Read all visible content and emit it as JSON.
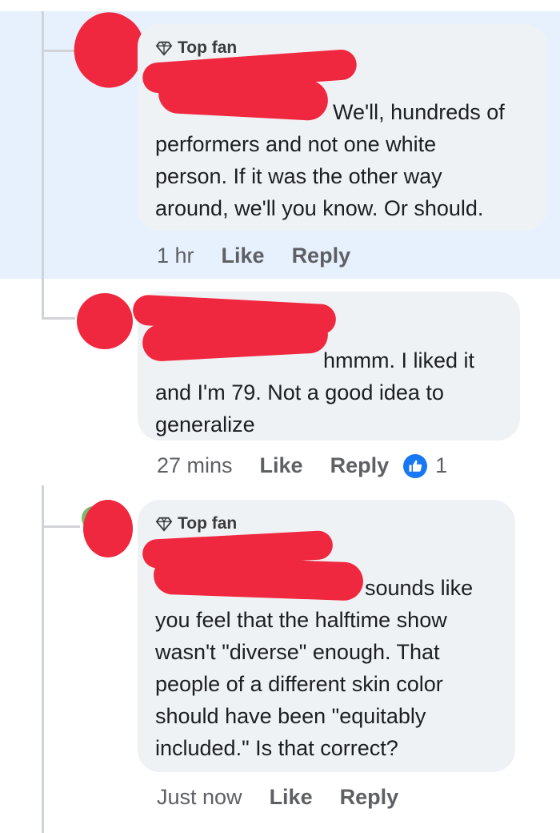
{
  "colors": {
    "highlight": "#e7f1fe",
    "bubble": "#eff2f5",
    "redaction": "#f0283f",
    "like_blue": "#1877f2"
  },
  "comments": [
    {
      "badge": "Top fan",
      "text_lines": [
        "We'll, hundreds of",
        "performers and not one white",
        "person. If it was the other way",
        "around, we'll you know. Or should."
      ],
      "time": "1 hr",
      "like": "Like",
      "reply": "Reply"
    },
    {
      "text_lines": [
        "hmmm. I liked it",
        "and I'm 79. Not a good idea to",
        "generalize"
      ],
      "time": "27 mins",
      "like": "Like",
      "reply": "Reply",
      "reaction_count": "1",
      "reaction_icon": "thumbs-up-icon"
    },
    {
      "badge": "Top fan",
      "text_lines": [
        "sounds like",
        "you feel that the halftime show",
        "wasn't \"diverse\" enough. That",
        "people of a different skin color",
        "should have been \"equitably",
        "included.\" Is that correct?"
      ],
      "time": "Just now",
      "like": "Like",
      "reply": "Reply"
    }
  ]
}
